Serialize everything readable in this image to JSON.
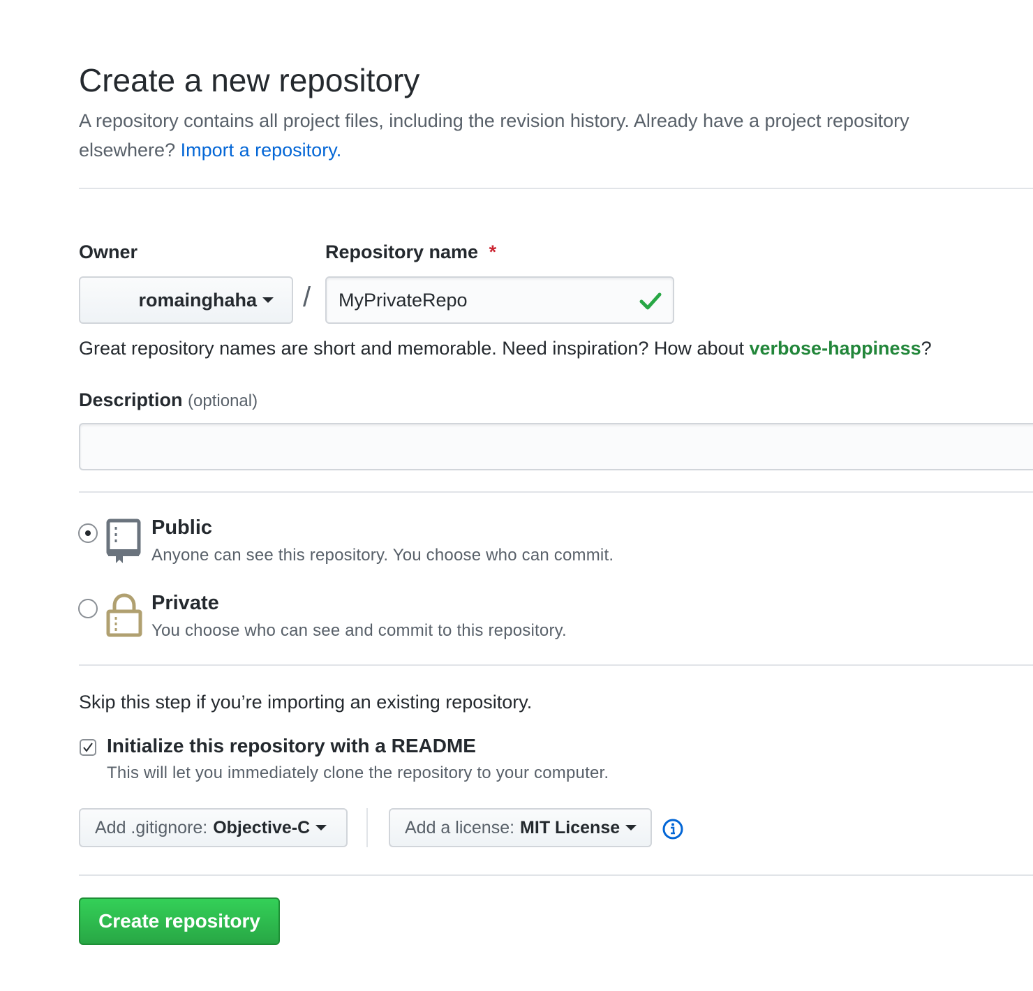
{
  "page": {
    "title": "Create a new repository",
    "subtitle": "A repository contains all project files, including the revision history. Already have a project repository elsewhere?",
    "import_link": "Import a repository."
  },
  "owner": {
    "label": "Owner",
    "value": "romainghaha"
  },
  "separator": "/",
  "repo_name": {
    "label": "Repository name",
    "required_mark": "*",
    "value": "MyPrivateRepo"
  },
  "suggestion": {
    "text": "Great repository names are short and memorable. Need inspiration? How about",
    "name": "verbose-happiness",
    "suffix": "?"
  },
  "description": {
    "label": "Description",
    "optional": "(optional)",
    "value": ""
  },
  "visibility": {
    "selected": "public",
    "public": {
      "title": "Public",
      "desc": "Anyone can see this repository. You choose who can commit."
    },
    "private": {
      "title": "Private",
      "desc": "You choose who can see and commit to this repository."
    }
  },
  "init": {
    "skip_text": "Skip this step if you’re importing an existing repository.",
    "readme_label": "Initialize this repository with a README",
    "readme_checked": true,
    "readme_desc": "This will let you immediately clone the repository to your computer."
  },
  "gitignore": {
    "prefix": "Add .gitignore:",
    "value": "Objective-C"
  },
  "license": {
    "prefix": "Add a license:",
    "value": "MIT License"
  },
  "submit": {
    "label": "Create repository"
  },
  "colors": {
    "link": "#0366d6",
    "success": "#28a745",
    "suggestion": "#22863a",
    "required": "#cb2431"
  }
}
